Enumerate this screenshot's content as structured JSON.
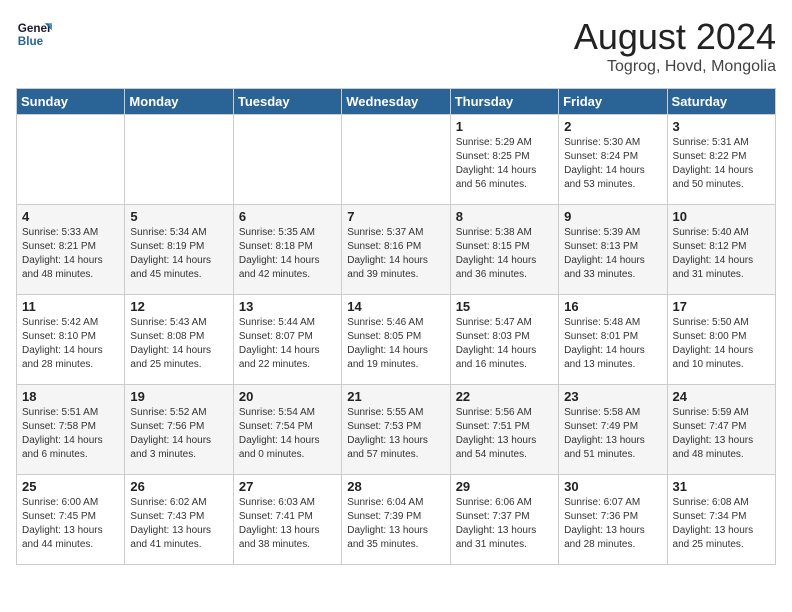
{
  "header": {
    "logo_line1": "General",
    "logo_line2": "Blue",
    "month": "August 2024",
    "location": "Togrog, Hovd, Mongolia"
  },
  "days_of_week": [
    "Sunday",
    "Monday",
    "Tuesday",
    "Wednesday",
    "Thursday",
    "Friday",
    "Saturday"
  ],
  "weeks": [
    [
      {
        "day": "",
        "info": ""
      },
      {
        "day": "",
        "info": ""
      },
      {
        "day": "",
        "info": ""
      },
      {
        "day": "",
        "info": ""
      },
      {
        "day": "1",
        "info": "Sunrise: 5:29 AM\nSunset: 8:25 PM\nDaylight: 14 hours\nand 56 minutes."
      },
      {
        "day": "2",
        "info": "Sunrise: 5:30 AM\nSunset: 8:24 PM\nDaylight: 14 hours\nand 53 minutes."
      },
      {
        "day": "3",
        "info": "Sunrise: 5:31 AM\nSunset: 8:22 PM\nDaylight: 14 hours\nand 50 minutes."
      }
    ],
    [
      {
        "day": "4",
        "info": "Sunrise: 5:33 AM\nSunset: 8:21 PM\nDaylight: 14 hours\nand 48 minutes."
      },
      {
        "day": "5",
        "info": "Sunrise: 5:34 AM\nSunset: 8:19 PM\nDaylight: 14 hours\nand 45 minutes."
      },
      {
        "day": "6",
        "info": "Sunrise: 5:35 AM\nSunset: 8:18 PM\nDaylight: 14 hours\nand 42 minutes."
      },
      {
        "day": "7",
        "info": "Sunrise: 5:37 AM\nSunset: 8:16 PM\nDaylight: 14 hours\nand 39 minutes."
      },
      {
        "day": "8",
        "info": "Sunrise: 5:38 AM\nSunset: 8:15 PM\nDaylight: 14 hours\nand 36 minutes."
      },
      {
        "day": "9",
        "info": "Sunrise: 5:39 AM\nSunset: 8:13 PM\nDaylight: 14 hours\nand 33 minutes."
      },
      {
        "day": "10",
        "info": "Sunrise: 5:40 AM\nSunset: 8:12 PM\nDaylight: 14 hours\nand 31 minutes."
      }
    ],
    [
      {
        "day": "11",
        "info": "Sunrise: 5:42 AM\nSunset: 8:10 PM\nDaylight: 14 hours\nand 28 minutes."
      },
      {
        "day": "12",
        "info": "Sunrise: 5:43 AM\nSunset: 8:08 PM\nDaylight: 14 hours\nand 25 minutes."
      },
      {
        "day": "13",
        "info": "Sunrise: 5:44 AM\nSunset: 8:07 PM\nDaylight: 14 hours\nand 22 minutes."
      },
      {
        "day": "14",
        "info": "Sunrise: 5:46 AM\nSunset: 8:05 PM\nDaylight: 14 hours\nand 19 minutes."
      },
      {
        "day": "15",
        "info": "Sunrise: 5:47 AM\nSunset: 8:03 PM\nDaylight: 14 hours\nand 16 minutes."
      },
      {
        "day": "16",
        "info": "Sunrise: 5:48 AM\nSunset: 8:01 PM\nDaylight: 14 hours\nand 13 minutes."
      },
      {
        "day": "17",
        "info": "Sunrise: 5:50 AM\nSunset: 8:00 PM\nDaylight: 14 hours\nand 10 minutes."
      }
    ],
    [
      {
        "day": "18",
        "info": "Sunrise: 5:51 AM\nSunset: 7:58 PM\nDaylight: 14 hours\nand 6 minutes."
      },
      {
        "day": "19",
        "info": "Sunrise: 5:52 AM\nSunset: 7:56 PM\nDaylight: 14 hours\nand 3 minutes."
      },
      {
        "day": "20",
        "info": "Sunrise: 5:54 AM\nSunset: 7:54 PM\nDaylight: 14 hours\nand 0 minutes."
      },
      {
        "day": "21",
        "info": "Sunrise: 5:55 AM\nSunset: 7:53 PM\nDaylight: 13 hours\nand 57 minutes."
      },
      {
        "day": "22",
        "info": "Sunrise: 5:56 AM\nSunset: 7:51 PM\nDaylight: 13 hours\nand 54 minutes."
      },
      {
        "day": "23",
        "info": "Sunrise: 5:58 AM\nSunset: 7:49 PM\nDaylight: 13 hours\nand 51 minutes."
      },
      {
        "day": "24",
        "info": "Sunrise: 5:59 AM\nSunset: 7:47 PM\nDaylight: 13 hours\nand 48 minutes."
      }
    ],
    [
      {
        "day": "25",
        "info": "Sunrise: 6:00 AM\nSunset: 7:45 PM\nDaylight: 13 hours\nand 44 minutes."
      },
      {
        "day": "26",
        "info": "Sunrise: 6:02 AM\nSunset: 7:43 PM\nDaylight: 13 hours\nand 41 minutes."
      },
      {
        "day": "27",
        "info": "Sunrise: 6:03 AM\nSunset: 7:41 PM\nDaylight: 13 hours\nand 38 minutes."
      },
      {
        "day": "28",
        "info": "Sunrise: 6:04 AM\nSunset: 7:39 PM\nDaylight: 13 hours\nand 35 minutes."
      },
      {
        "day": "29",
        "info": "Sunrise: 6:06 AM\nSunset: 7:37 PM\nDaylight: 13 hours\nand 31 minutes."
      },
      {
        "day": "30",
        "info": "Sunrise: 6:07 AM\nSunset: 7:36 PM\nDaylight: 13 hours\nand 28 minutes."
      },
      {
        "day": "31",
        "info": "Sunrise: 6:08 AM\nSunset: 7:34 PM\nDaylight: 13 hours\nand 25 minutes."
      }
    ]
  ]
}
